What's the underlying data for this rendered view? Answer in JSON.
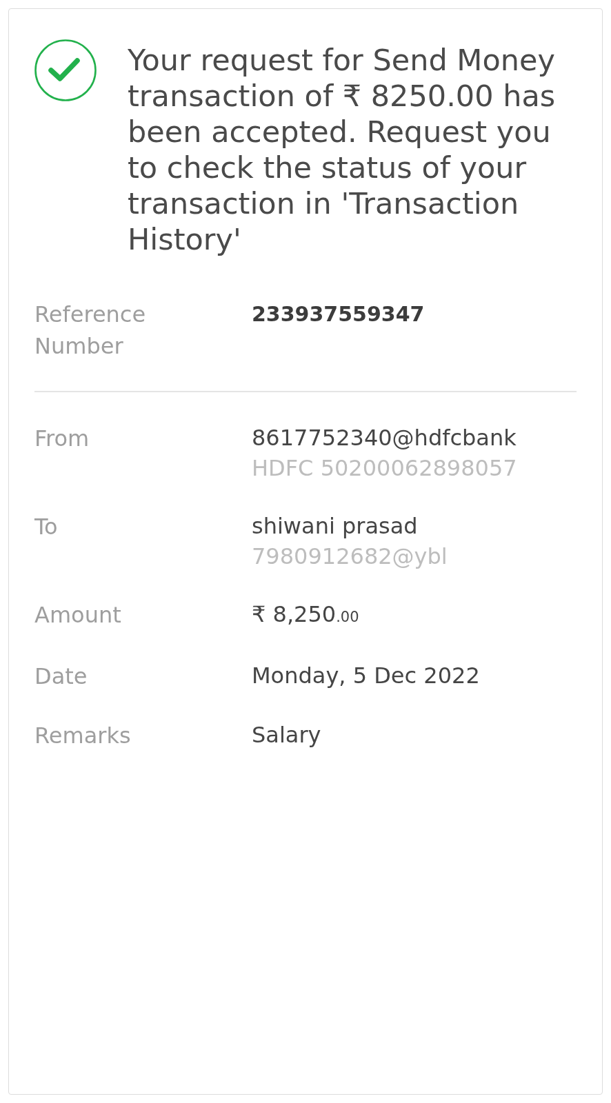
{
  "message": "Your request for Send Money transaction of ₹ 8250.00 has been accepted. Request you to check the status of your transaction in 'Transaction History'",
  "details": [
    {
      "kind": "reference",
      "label": "Reference Number",
      "value": "233937559347"
    },
    {
      "kind": "party",
      "label": "From",
      "value": "8617752340@hdfcbank",
      "sub": "HDFC 50200062898057"
    },
    {
      "kind": "party",
      "label": "To",
      "value": "shiwani prasad",
      "sub": "7980912682@ybl"
    },
    {
      "kind": "amount",
      "label": "Amount",
      "value": "₹ 8,250",
      "fraction": ".00"
    },
    {
      "kind": "plain",
      "label": "Date",
      "value": "Monday, 5 Dec 2022"
    },
    {
      "kind": "plain",
      "label": "Remarks",
      "value": "Salary"
    }
  ]
}
